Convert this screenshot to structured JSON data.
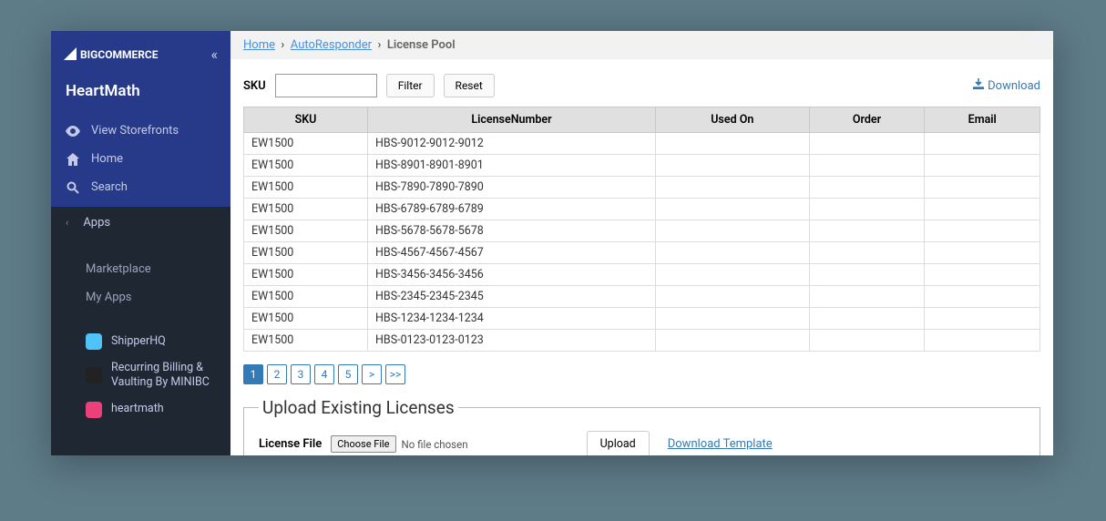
{
  "brand": "BIGCOMMERCE",
  "store_name": "HeartMath",
  "nav": {
    "view_storefronts": "View Storefronts",
    "home": "Home",
    "search": "Search",
    "apps": "Apps",
    "marketplace": "Marketplace",
    "my_apps": "My Apps"
  },
  "apps": [
    {
      "label": "ShipperHQ",
      "color": "#4fc3f7"
    },
    {
      "label": "Recurring Billing & Vaulting By MINIBC",
      "color": "#222"
    },
    {
      "label": "heartmath",
      "color": "#ec407a"
    }
  ],
  "breadcrumb": {
    "home": "Home",
    "auto": "AutoResponder",
    "current": "License Pool"
  },
  "filter": {
    "sku_label": "SKU",
    "filter_btn": "Filter",
    "reset_btn": "Reset",
    "download": "Download"
  },
  "table": {
    "headers": [
      "SKU",
      "LicenseNumber",
      "Used On",
      "Order",
      "Email"
    ],
    "rows": [
      {
        "sku": "EW1500",
        "license": "HBS-9012-9012-9012",
        "used_on": "",
        "order": "",
        "email": ""
      },
      {
        "sku": "EW1500",
        "license": "HBS-8901-8901-8901",
        "used_on": "",
        "order": "",
        "email": ""
      },
      {
        "sku": "EW1500",
        "license": "HBS-7890-7890-7890",
        "used_on": "",
        "order": "",
        "email": ""
      },
      {
        "sku": "EW1500",
        "license": "HBS-6789-6789-6789",
        "used_on": "",
        "order": "",
        "email": ""
      },
      {
        "sku": "EW1500",
        "license": "HBS-5678-5678-5678",
        "used_on": "",
        "order": "",
        "email": ""
      },
      {
        "sku": "EW1500",
        "license": "HBS-4567-4567-4567",
        "used_on": "",
        "order": "",
        "email": ""
      },
      {
        "sku": "EW1500",
        "license": "HBS-3456-3456-3456",
        "used_on": "",
        "order": "",
        "email": ""
      },
      {
        "sku": "EW1500",
        "license": "HBS-2345-2345-2345",
        "used_on": "",
        "order": "",
        "email": ""
      },
      {
        "sku": "EW1500",
        "license": "HBS-1234-1234-1234",
        "used_on": "",
        "order": "",
        "email": ""
      },
      {
        "sku": "EW1500",
        "license": "HBS-0123-0123-0123",
        "used_on": "",
        "order": "",
        "email": ""
      }
    ]
  },
  "pagination": [
    "1",
    "2",
    "3",
    "4",
    "5",
    ">",
    ">>"
  ],
  "upload": {
    "legend": "Upload Existing Licenses",
    "file_label": "License File",
    "choose": "Choose File",
    "no_file": "No file chosen",
    "upload_btn": "Upload",
    "template_link": "Download Template"
  }
}
